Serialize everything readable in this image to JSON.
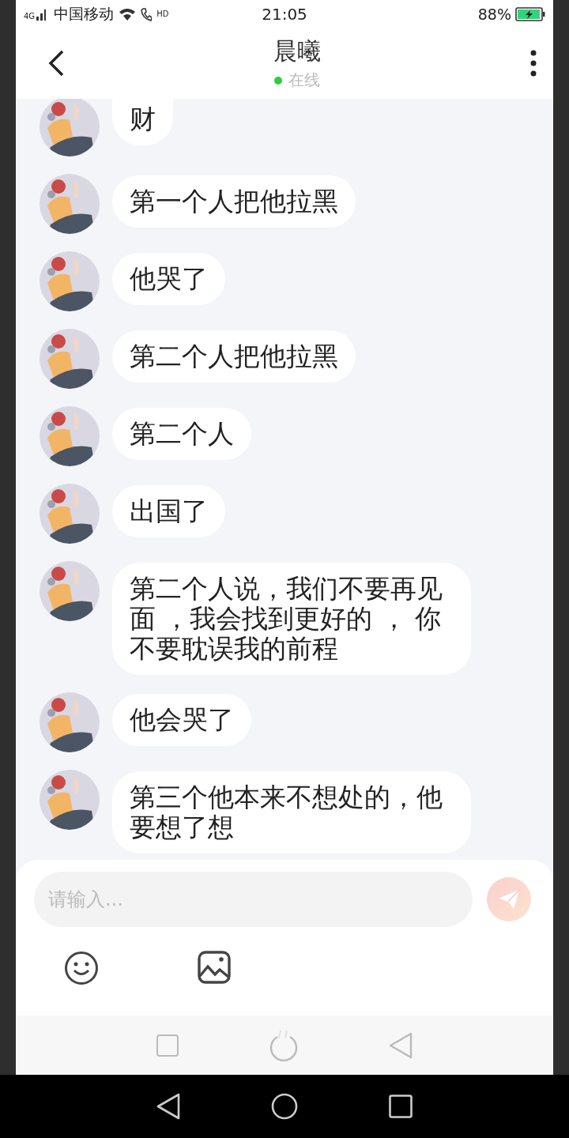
{
  "status_bar": {
    "network": "4G",
    "carrier": "中国移动",
    "call_badge": "HD",
    "time": "21:05",
    "battery": "88%",
    "charging": true
  },
  "header": {
    "title": "晨曦",
    "status": "在线",
    "online": true
  },
  "messages": [
    {
      "text": "财",
      "clipped": true
    },
    {
      "text": "第一个人把他拉黑",
      "clipped": false
    },
    {
      "text": "他哭了",
      "clipped": false
    },
    {
      "text": "第二个人把他拉黑",
      "clipped": false
    },
    {
      "text": "第二个人",
      "clipped": false
    },
    {
      "text": "出国了",
      "clipped": false
    },
    {
      "text": "第二个人说，我们不要再见面 ，我会找到更好的 ， 你不要耽误我的前程",
      "clipped": false
    },
    {
      "text": "他会哭了",
      "clipped": false
    },
    {
      "text": "第三个他本来不想处的，他要想了想",
      "clipped": false
    }
  ],
  "composer": {
    "placeholder": "请输入...",
    "send_enabled": false
  }
}
